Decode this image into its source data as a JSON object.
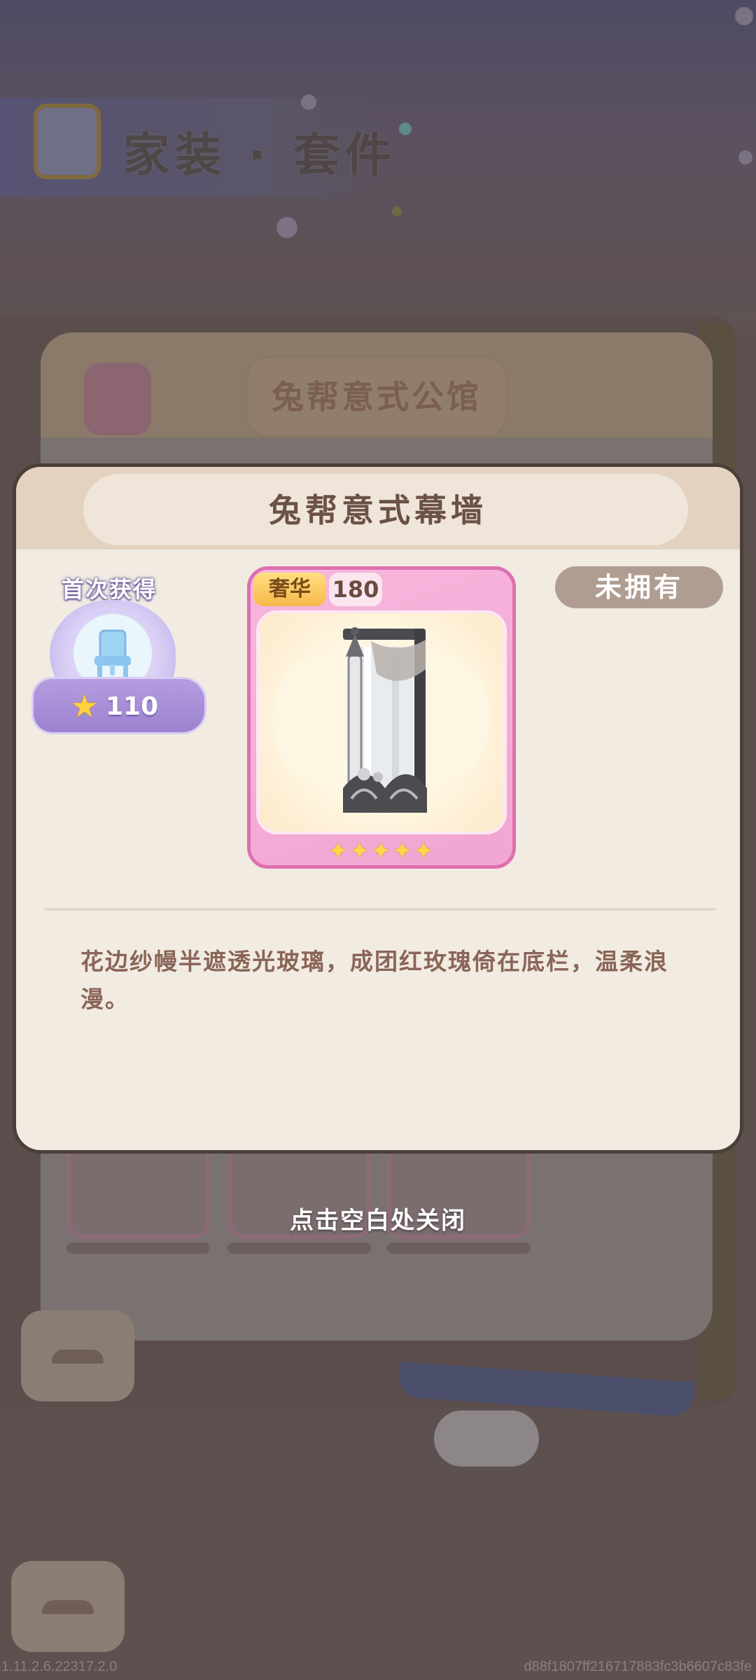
{
  "background": {
    "header_title": "家装 · 套件",
    "tab_title": "兔帮意式公馆"
  },
  "dialog": {
    "title": "兔帮意式幕墙",
    "status": "未拥有",
    "first_acquire": {
      "label": "首次获得",
      "reward_icon": "star-icon",
      "amount": "110"
    },
    "item": {
      "rarity": "奢华",
      "comfort": "180",
      "stars": "✦✦✦✦✦",
      "star_count": 5
    },
    "description": "花边纱幔半遮透光玻璃，成团红玫瑰倚在底栏，温柔浪漫。"
  },
  "close_hint": "点击空白处关闭",
  "version": "1.11.2.6.22317.2.0",
  "device_hash": "d88f1807ff216717883fc3b6607c83fe",
  "colors": {
    "dialog_bg": "#f1ebe2",
    "dialog_header": "#e3d2c0",
    "title_text": "#6b5147",
    "description_text": "#8a6558",
    "status_badge": "#b09d92",
    "card_border": "#de6fb1"
  }
}
